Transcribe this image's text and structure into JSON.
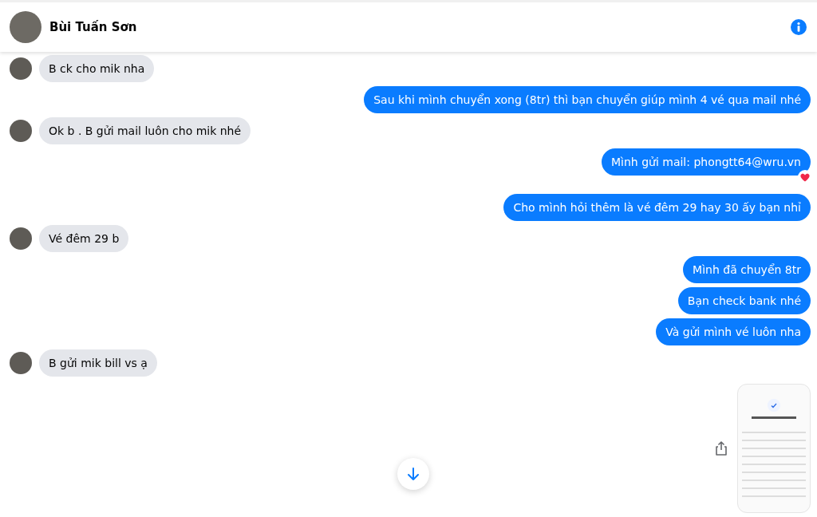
{
  "header": {
    "name": "Bùi Tuấn Sơn"
  },
  "messages": [
    {
      "kind": "incoming",
      "text": "B ck cho mik nha"
    },
    {
      "kind": "outgoing",
      "text": "Sau khi mình chuyển xong (8tr) thì bạn chuyển giúp mình 4 vé qua mail nhé"
    },
    {
      "kind": "incoming",
      "text": "Ok b . B gửi mail luôn cho mik nhé"
    },
    {
      "kind": "outgoing",
      "text": "Mình gửi mail: phongtt64@wru.vn",
      "reaction": true
    },
    {
      "kind": "outgoing",
      "text": "Cho mình hỏi thêm là vé đêm 29 hay 30 ấy bạn nhỉ"
    },
    {
      "kind": "incoming",
      "text": "Vé đêm 29 b"
    },
    {
      "kind": "outgoing",
      "text": "Mình đã chuyển 8tr"
    },
    {
      "kind": "outgoing",
      "text": "Bạn check bank nhé"
    },
    {
      "kind": "outgoing",
      "text": "Và gửi mình vé luôn nha"
    },
    {
      "kind": "incoming",
      "text": "B gửi mik bill vs ạ"
    }
  ]
}
